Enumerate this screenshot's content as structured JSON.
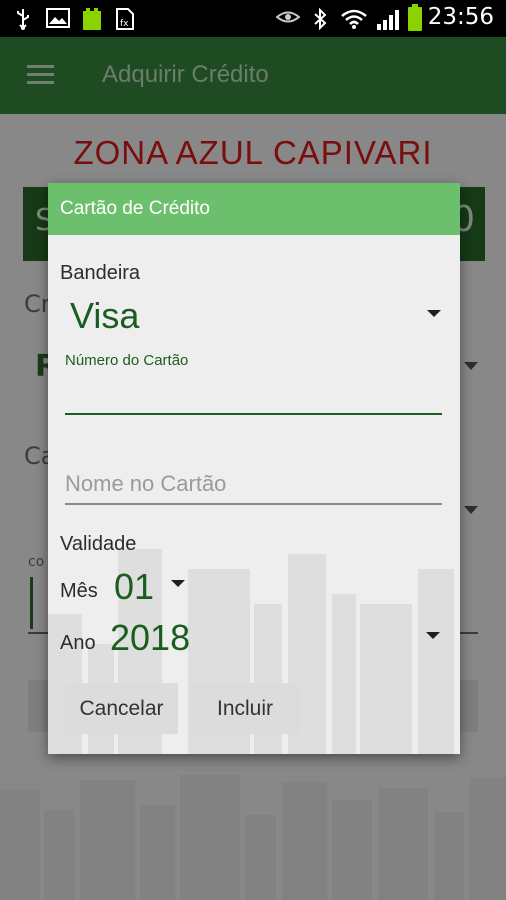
{
  "status_bar": {
    "time": "23:56",
    "icons": [
      "usb-icon",
      "image-icon",
      "android-icon",
      "file-icon",
      "eye-icon",
      "bluetooth-icon",
      "wifi-icon",
      "signal-icon",
      "battery-icon"
    ]
  },
  "app_bar": {
    "title": "Adquirir Crédito",
    "menu_icon": "hamburger-menu-icon"
  },
  "background": {
    "title": "ZONA AZUL CAPIVARI",
    "saldo_left": "S",
    "saldo_right": "0",
    "label_a": "Cr",
    "value_a": "R",
    "label_b": "Ca",
    "label_c": "co"
  },
  "dialog": {
    "title": "Cartão de Crédito",
    "bandeira_label": "Bandeira",
    "bandeira_value": "Visa",
    "card_number_label": "Número do Cartão",
    "card_number_value": "",
    "card_name_placeholder": "Nome no Cartão",
    "validade_label": "Validade",
    "mes_label": "Mês",
    "mes_value": "01",
    "ano_label": "Ano",
    "ano_value": "2018",
    "cancel_label": "Cancelar",
    "include_label": "Incluir"
  },
  "colors": {
    "app_bar": "#1f4b22",
    "dialog_header": "#6cbf6c",
    "accent_green": "#1a5e1f",
    "title_red": "#7a0d0d"
  }
}
